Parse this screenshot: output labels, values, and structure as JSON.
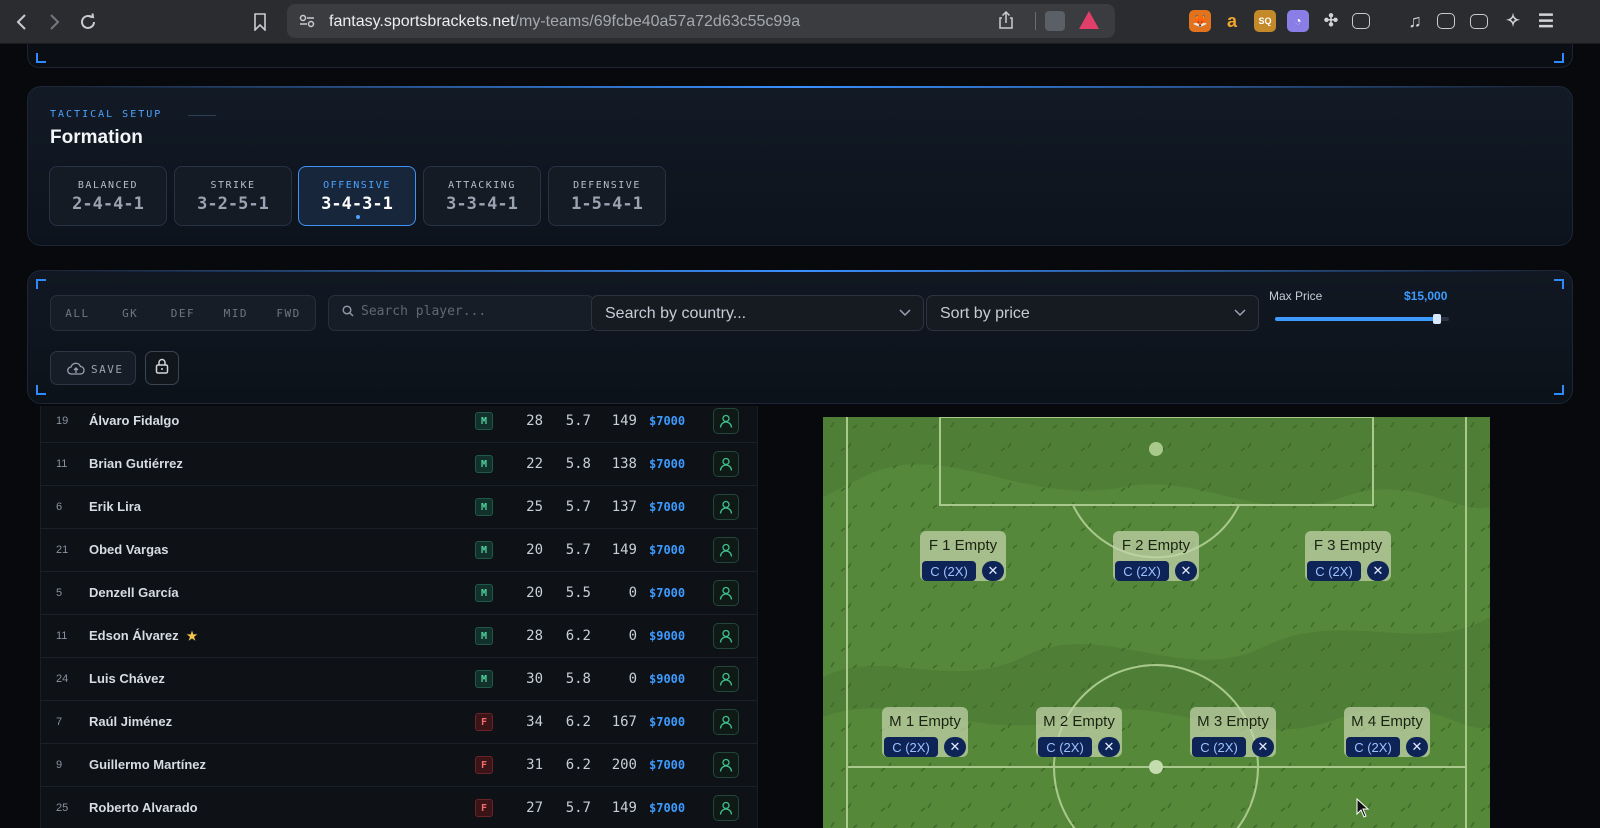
{
  "browser": {
    "url_host": "fantasy.sportsbrackets.net",
    "url_path": "/my-teams/69fcbe40a57a72d63c55c99a"
  },
  "formation": {
    "section_label": "TACTICAL SETUP",
    "title": "Formation",
    "options": [
      {
        "name": "BALANCED",
        "value": "2-4-4-1",
        "active": false
      },
      {
        "name": "STRIKE",
        "value": "3-2-5-1",
        "active": false
      },
      {
        "name": "OFFENSIVE",
        "value": "3-4-3-1",
        "active": true
      },
      {
        "name": "ATTACKING",
        "value": "3-3-4-1",
        "active": false
      },
      {
        "name": "DEFENSIVE",
        "value": "1-5-4-1",
        "active": false
      }
    ]
  },
  "filters": {
    "positions": [
      "ALL",
      "GK",
      "DEF",
      "MID",
      "FWD"
    ],
    "search_placeholder": "Search player...",
    "country_placeholder": "Search by country...",
    "sort_value": "Sort by price",
    "max_price_label": "Max Price",
    "max_price_value": "$15,000",
    "max_price_fraction": 0.93,
    "save_label": "SAVE"
  },
  "players": [
    {
      "number": "19",
      "name": "Álvaro Fidalgo",
      "pos": "M",
      "age": "28",
      "rating": "5.7",
      "points": "149",
      "price": "$7000",
      "star": false
    },
    {
      "number": "11",
      "name": "Brian Gutiérrez",
      "pos": "M",
      "age": "22",
      "rating": "5.8",
      "points": "138",
      "price": "$7000",
      "star": false
    },
    {
      "number": "6",
      "name": "Erik Lira",
      "pos": "M",
      "age": "25",
      "rating": "5.7",
      "points": "137",
      "price": "$7000",
      "star": false
    },
    {
      "number": "21",
      "name": "Obed Vargas",
      "pos": "M",
      "age": "20",
      "rating": "5.7",
      "points": "149",
      "price": "$7000",
      "star": false
    },
    {
      "number": "5",
      "name": "Denzell García",
      "pos": "M",
      "age": "20",
      "rating": "5.5",
      "points": "0",
      "price": "$7000",
      "star": false
    },
    {
      "number": "11",
      "name": "Edson Álvarez",
      "pos": "M",
      "age": "28",
      "rating": "6.2",
      "points": "0",
      "price": "$9000",
      "star": true
    },
    {
      "number": "24",
      "name": "Luis Chávez",
      "pos": "M",
      "age": "30",
      "rating": "5.8",
      "points": "0",
      "price": "$9000",
      "star": false
    },
    {
      "number": "7",
      "name": "Raúl Jiménez",
      "pos": "F",
      "age": "34",
      "rating": "6.2",
      "points": "167",
      "price": "$7000",
      "star": false
    },
    {
      "number": "9",
      "name": "Guillermo Martínez",
      "pos": "F",
      "age": "31",
      "rating": "6.2",
      "points": "200",
      "price": "$7000",
      "star": false
    },
    {
      "number": "25",
      "name": "Roberto Alvarado",
      "pos": "F",
      "age": "27",
      "rating": "5.7",
      "points": "149",
      "price": "$7000",
      "star": false
    }
  ],
  "pitch": {
    "captain_label": "C (2X)",
    "remove_symbol": "✕",
    "slots": [
      {
        "label": "F 1 Empty"
      },
      {
        "label": "F 2 Empty"
      },
      {
        "label": "F 3 Empty"
      },
      {
        "label": "M 1 Empty"
      },
      {
        "label": "M 2 Empty"
      },
      {
        "label": "M 3 Empty"
      },
      {
        "label": "M 4 Empty"
      }
    ]
  },
  "colors": {
    "accent": "#3d9bff",
    "midfielder": "#52d3a0",
    "forward": "#f06b6b",
    "pitch": "#4e7d35"
  }
}
